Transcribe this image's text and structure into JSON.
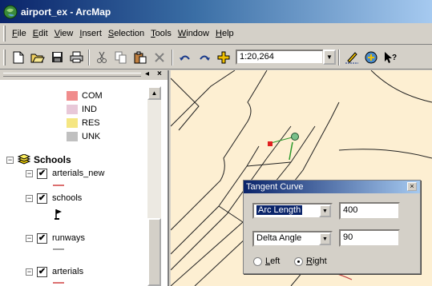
{
  "window": {
    "title": "airport_ex - ArcMap"
  },
  "menu": [
    {
      "label": "File",
      "accel": "F",
      "rest": "ile"
    },
    {
      "label": "Edit",
      "accel": "E",
      "rest": "dit"
    },
    {
      "label": "View",
      "accel": "V",
      "rest": "iew"
    },
    {
      "label": "Insert",
      "accel": "I",
      "rest": "nsert"
    },
    {
      "label": "Selection",
      "accel": "S",
      "rest": "election"
    },
    {
      "label": "Tools",
      "accel": "T",
      "rest": "ools"
    },
    {
      "label": "Window",
      "accel": "W",
      "rest": "indow"
    },
    {
      "label": "Help",
      "accel": "H",
      "rest": "elp"
    }
  ],
  "toolbar": {
    "scale": "1:20,264"
  },
  "toc": {
    "legend": [
      {
        "label": "COM",
        "color": "#f08c8c"
      },
      {
        "label": "IND",
        "color": "#e8c8d8"
      },
      {
        "label": "RES",
        "color": "#f5e682"
      },
      {
        "label": "UNK",
        "color": "#c0c0c0"
      }
    ],
    "group": {
      "label": "Schools",
      "expanded": "⊟"
    },
    "layers": [
      {
        "label": "arterials_new",
        "checked": "✔"
      },
      {
        "label": "schools",
        "checked": "✔"
      },
      {
        "label": "runways",
        "checked": "✔"
      },
      {
        "label": "arterials",
        "checked": "✔"
      }
    ]
  },
  "dialog": {
    "title": "Tangent Curve",
    "field1": {
      "selected": "Arc Length",
      "value": "400"
    },
    "field2": {
      "selected": "Delta Angle",
      "value": "90"
    },
    "radio_left": {
      "accel": "L",
      "rest": "eft",
      "checked": false
    },
    "radio_right": {
      "accel": "R",
      "rest": "ight",
      "checked": true
    }
  }
}
